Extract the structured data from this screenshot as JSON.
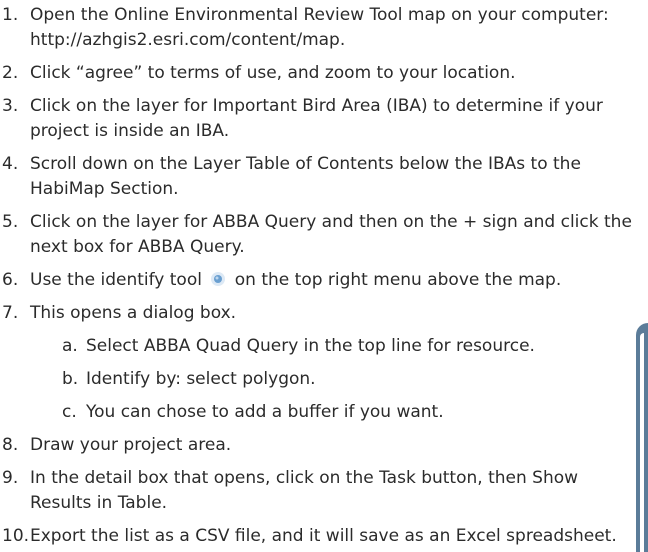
{
  "steps": [
    {
      "num": "1.",
      "text": "Open the Online Environmental Review Tool map on your computer: http://azhgis2.esri.com/content/map."
    },
    {
      "num": "2.",
      "text": "Click “agree” to terms of use, and zoom to your location."
    },
    {
      "num": "3.",
      "text": "Click on the layer for Important Bird Area (IBA) to determine if your project is inside an IBA."
    },
    {
      "num": "4.",
      "text": "Scroll down on the Layer Table of Contents below the IBAs to the HabiMap Section."
    },
    {
      "num": "5.",
      "text": "Click on the layer for ABBA Query and then on the + sign and click the next box for ABBA Query."
    },
    {
      "num": "6.",
      "text_before": "Use the identify tool",
      "text_after": "on the top right menu above the map."
    },
    {
      "num": "7.",
      "text": "This opens a dialog box."
    },
    {
      "num": "8.",
      "text": "Draw your project area."
    },
    {
      "num": "9.",
      "text": "In the detail box that opens, click on the Task button, then Show Results in Table."
    },
    {
      "num": "10.",
      "text": "Export the list as a CSV file, and it will save as an Excel spreadsheet."
    }
  ],
  "substeps": [
    {
      "letter": "a.",
      "text": "Select ABBA Quad Query in the top line for resource."
    },
    {
      "letter": "b.",
      "text": "Identify by: select polygon."
    },
    {
      "letter": "c.",
      "text": "You can chose to add a buffer if you want."
    }
  ],
  "icons": {
    "identify_tool": "identify-tool-icon"
  },
  "colors": {
    "text": "#2b2b2b",
    "side_tab": "#5b7c99",
    "identify_icon": "#6a9fd0"
  }
}
